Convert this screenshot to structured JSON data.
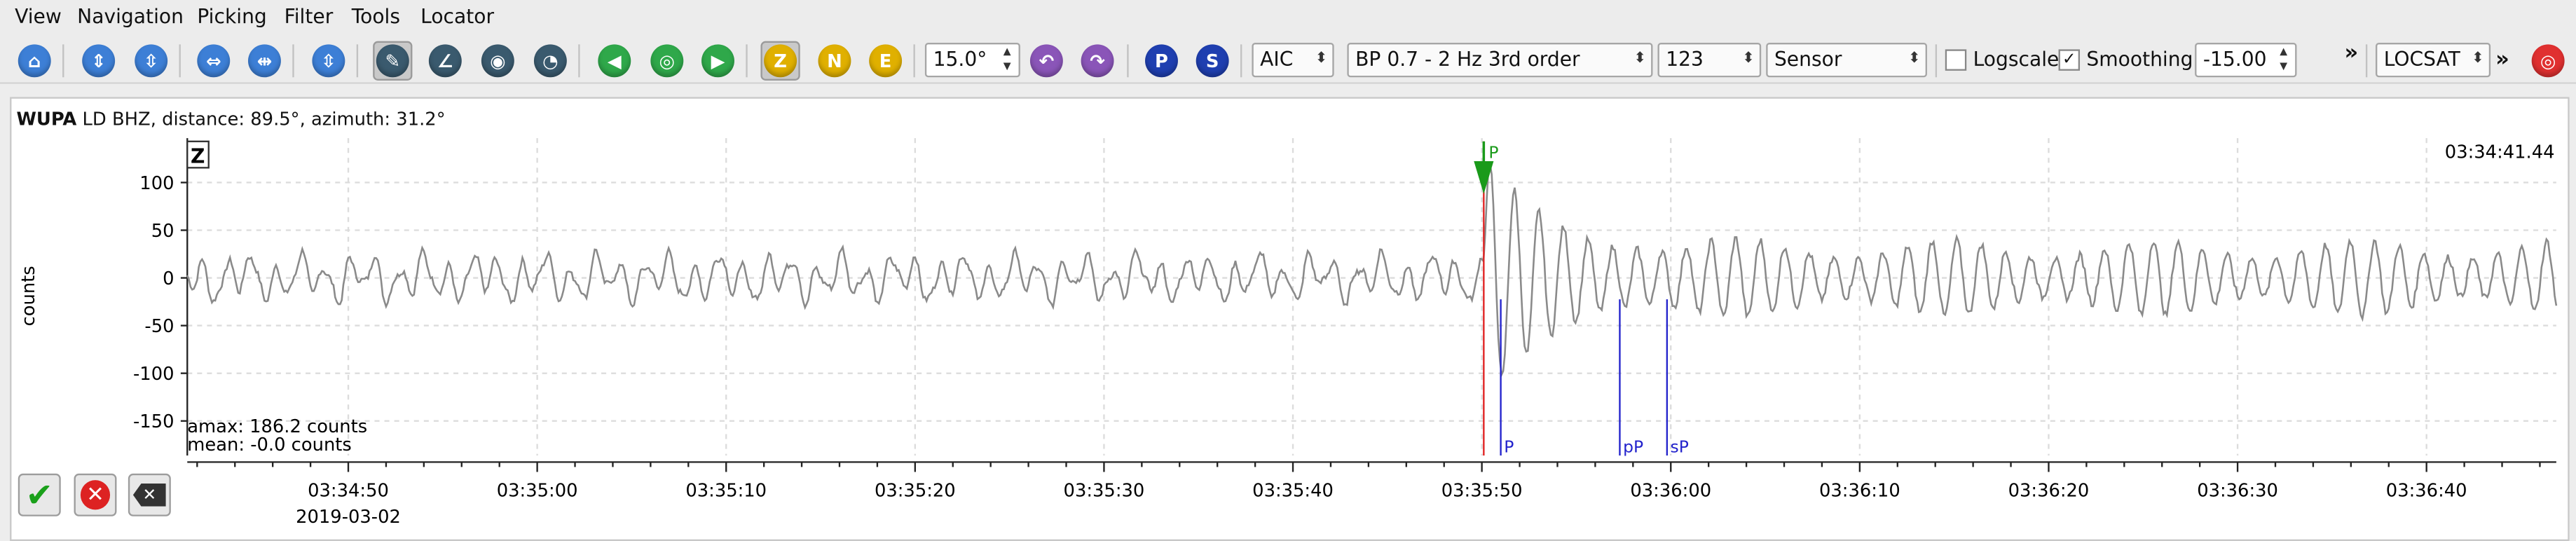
{
  "menu": [
    "View",
    "Navigation",
    "Picking",
    "Filter",
    "Tools",
    "Locator"
  ],
  "toolbar": {
    "component_buttons": [
      "Z",
      "N",
      "E"
    ],
    "phase_buttons": [
      "P",
      "S"
    ],
    "rotation_value": "15.0°",
    "picker": "AIC",
    "filter": "BP 0.7 - 2 Hz  3rd order",
    "amp_value": "123",
    "unit": "Sensor",
    "logscale_label": "Logscale",
    "logscale_checked": false,
    "smoothing_label": "Smoothing",
    "smoothing_checked": true,
    "smoothing_value": "-15.00",
    "overflow_1": "»",
    "locator": "LOCSAT",
    "overflow_2": "»"
  },
  "trace": {
    "station": "WUPA",
    "header_rest": "  LD  BHZ, distance: 89.5°, azimuth: 31.2°",
    "component": "Z",
    "time_readout": "03:34:41.44",
    "ylabel": "counts",
    "amax": "amax: 186.2 counts",
    "mean": "mean: -0.0 counts",
    "date": "2019-03-02",
    "yticks": [
      "100",
      "50",
      "0",
      "-50",
      "-100",
      "-150"
    ],
    "xticks": [
      "03:34:50",
      "03:35:00",
      "03:35:10",
      "03:35:20",
      "03:35:30",
      "03:35:40",
      "03:35:50",
      "03:36:00",
      "03:36:10",
      "03:36:20",
      "03:36:30",
      "03:36:40"
    ],
    "picks": [
      {
        "label": "P",
        "time": "03:35:50.1",
        "color": "#1a9a1a",
        "kind": "manual"
      },
      {
        "label": "P",
        "time": "03:35:51.0",
        "color": "#2222cc",
        "kind": "theoretical"
      },
      {
        "label": "pP",
        "time": "03:35:57.3",
        "color": "#2222cc",
        "kind": "theoretical"
      },
      {
        "label": "sP",
        "time": "03:35:59.8",
        "color": "#2222cc",
        "kind": "theoretical"
      }
    ]
  },
  "chart_data": {
    "type": "line",
    "title": "",
    "xlabel": "",
    "ylabel": "counts",
    "x_range": [
      "03:34:42",
      "03:36:47"
    ],
    "ylim": [
      -190,
      140
    ],
    "grid": true,
    "series": [
      {
        "values_description_none": true
      }
    ]
  },
  "colors": {
    "trace": "#8a8a8a",
    "manual_pick": "#1a9a1a",
    "pick_marker": "#e02020",
    "theoretical": "#2222cc",
    "accent": "#e0b000"
  }
}
